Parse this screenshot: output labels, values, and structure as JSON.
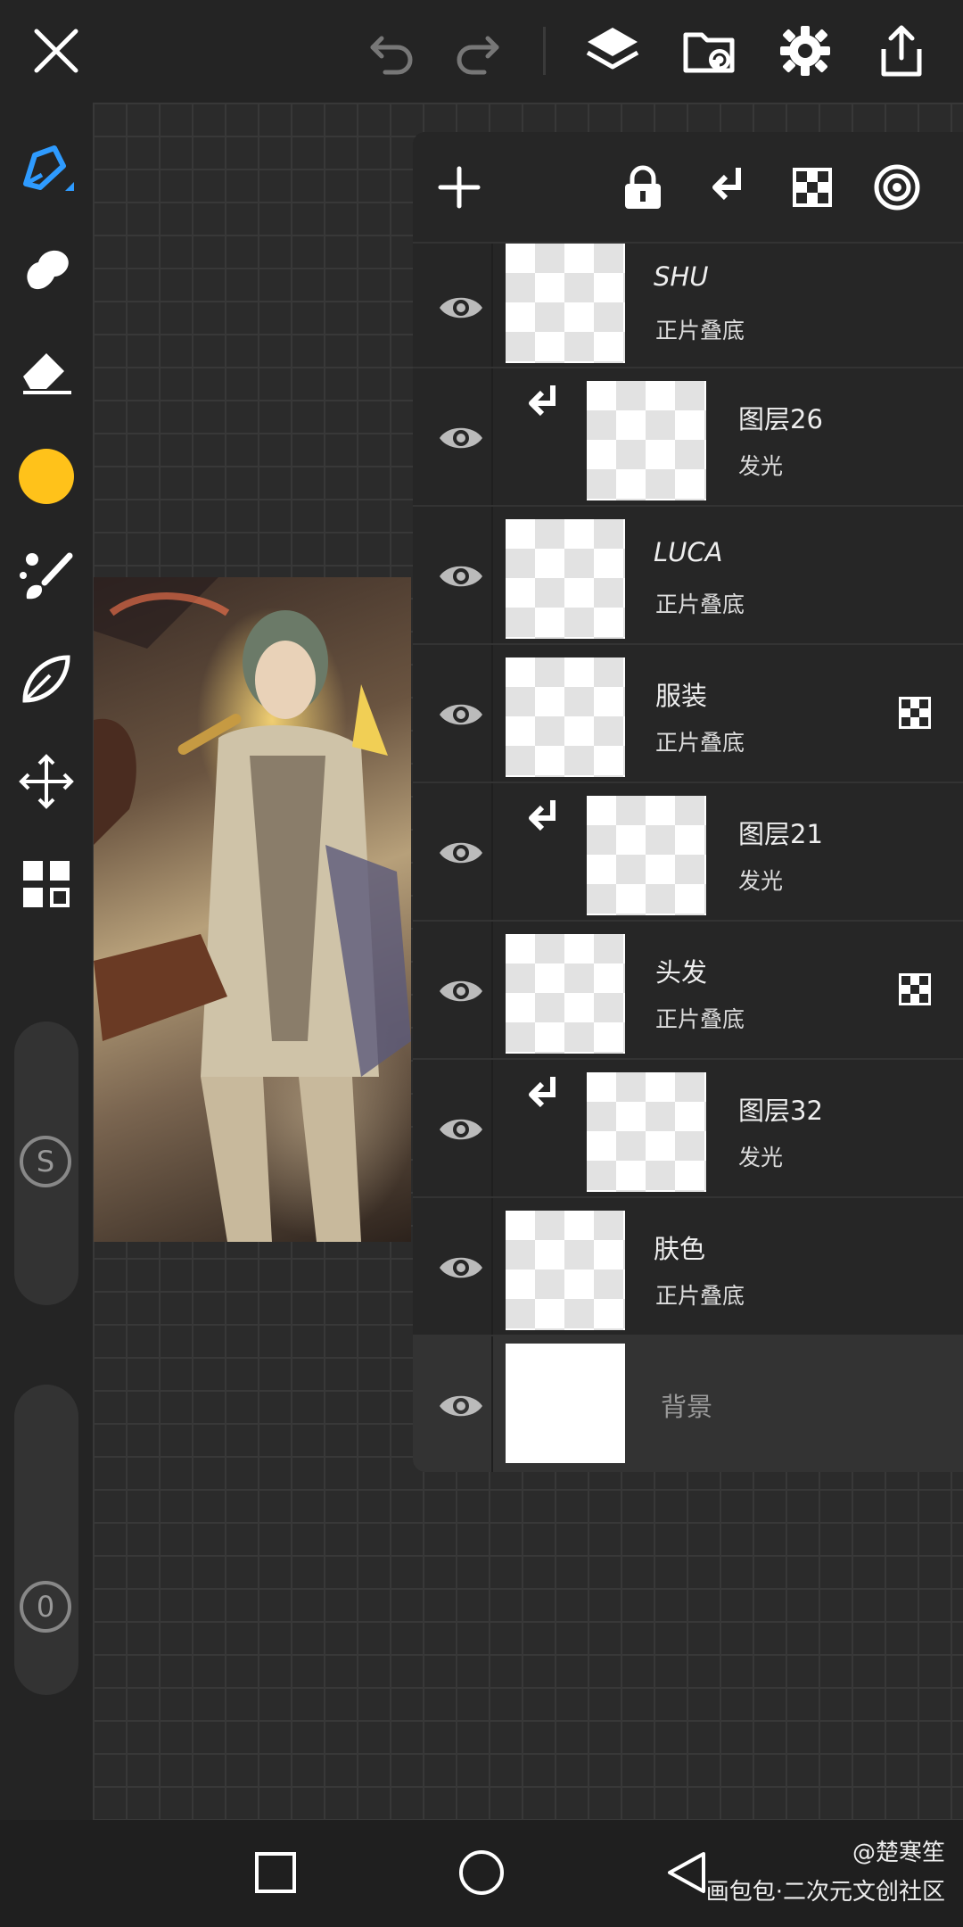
{
  "top_bar": {
    "icons": [
      "close-icon",
      "undo-icon",
      "redo-icon",
      "layers-icon",
      "import-icon",
      "settings-icon",
      "share-icon"
    ]
  },
  "left_toolbar": {
    "tools": [
      "brush-icon",
      "smudge-icon",
      "eraser-icon",
      "color-swatch",
      "filter-brush-icon",
      "lasso-icon",
      "transform-icon",
      "grid-icon"
    ],
    "active_color": "#FFC21A",
    "size_slider_label": "S",
    "opacity_slider_label": "0"
  },
  "layers_panel": {
    "toolbar_icons": [
      "add-icon",
      "lock-icon",
      "clip-icon",
      "alpha-lock-icon",
      "blend-icon"
    ],
    "layers": [
      {
        "name": "SHU",
        "mode": "正片叠底",
        "clipped": false,
        "alpha_locked": false,
        "selected": false
      },
      {
        "name": "图层26",
        "mode": "发光",
        "clipped": true,
        "alpha_locked": false,
        "selected": false
      },
      {
        "name": "LUCA",
        "mode": "正片叠底",
        "clipped": false,
        "alpha_locked": false,
        "selected": false
      },
      {
        "name": "服装",
        "mode": "正片叠底",
        "clipped": false,
        "alpha_locked": true,
        "selected": false
      },
      {
        "name": "图层21",
        "mode": "发光",
        "clipped": true,
        "alpha_locked": false,
        "selected": false
      },
      {
        "name": "头发",
        "mode": "正片叠底",
        "clipped": false,
        "alpha_locked": true,
        "selected": false
      },
      {
        "name": "图层32",
        "mode": "发光",
        "clipped": true,
        "alpha_locked": false,
        "selected": false
      },
      {
        "name": "肤色",
        "mode": "正片叠底",
        "clipped": false,
        "alpha_locked": false,
        "selected": false
      },
      {
        "name": "背景",
        "mode": "",
        "clipped": false,
        "alpha_locked": false,
        "selected": true
      }
    ]
  },
  "watermark": {
    "author": "@楚寒笙",
    "site": "画包包·二次元文创社区"
  },
  "colors": {
    "accent": "#2E9BFF",
    "panel_bg": "#262626"
  }
}
